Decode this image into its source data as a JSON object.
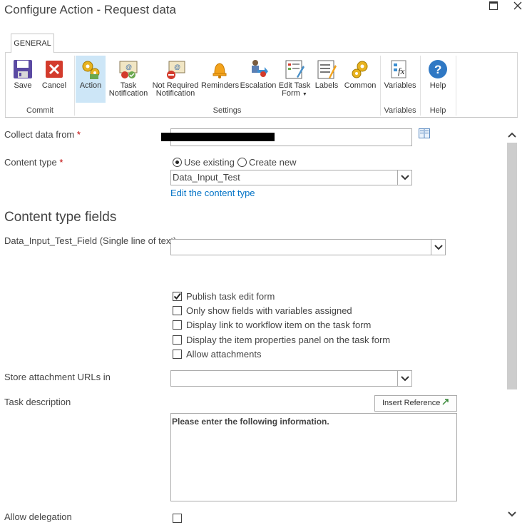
{
  "window": {
    "title": "Configure Action - Request data",
    "maximize_icon": "maximize-icon",
    "close_icon": "close-icon"
  },
  "ribbon": {
    "tab": "GENERAL",
    "buttons": {
      "save": "Save",
      "cancel": "Cancel",
      "action": "Action",
      "task_notification_1": "Task",
      "task_notification_2": "Notification",
      "not_required_1": "Not Required",
      "not_required_2": "Notification",
      "reminders": "Reminders",
      "escalation": "Escalation",
      "edit_task_form_1": "Edit Task",
      "edit_task_form_2": "Form",
      "labels": "Labels",
      "common": "Common",
      "variables": "Variables",
      "help": "Help"
    },
    "groups": {
      "commit": "Commit",
      "settings": "Settings",
      "variables": "Variables",
      "help": "Help"
    }
  },
  "form": {
    "collect_data_from": {
      "label": "Collect data from",
      "required": "*",
      "value": ""
    },
    "content_type": {
      "label": "Content type",
      "required": "*",
      "options": {
        "use_existing": "Use existing",
        "create_new": "Create new"
      },
      "selected_value": "Data_Input_Test",
      "edit_link": "Edit the content type"
    },
    "content_type_fields_heading": "Content type fields",
    "field_1": {
      "label": "Data_Input_Test_Field (Single line of text)",
      "value": ""
    },
    "checkboxes": [
      {
        "label": "Publish task edit form",
        "checked": true
      },
      {
        "label": "Only show fields with variables assigned",
        "checked": false
      },
      {
        "label": "Display link to workflow item on the task form",
        "checked": false
      },
      {
        "label": "Display the item properties panel on the task form",
        "checked": false
      },
      {
        "label": "Allow attachments",
        "checked": false
      }
    ],
    "store_attachment_urls": {
      "label": "Store attachment URLs in",
      "value": ""
    },
    "task_description": {
      "label": "Task description",
      "insert_reference": "Insert Reference",
      "text": "Please enter the following information."
    },
    "allow_delegation": {
      "label": "Allow delegation",
      "checked": false
    }
  }
}
